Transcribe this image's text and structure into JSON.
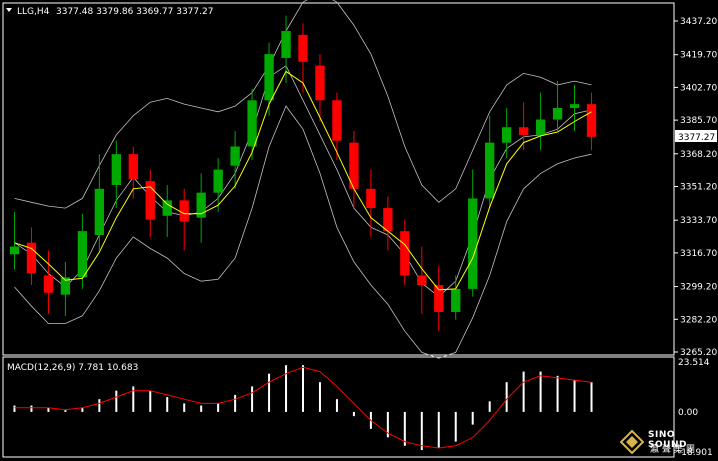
{
  "header": {
    "symbol": "LLG,H4",
    "ohlc": "3377.48 3379.86 3369.77 3377.27"
  },
  "price_axis": {
    "ticks": [
      "3437.20",
      "3419.70",
      "3402.70",
      "3385.70",
      "3368.20",
      "3351.20",
      "3333.70",
      "3316.70",
      "3299.20",
      "3282.20",
      "3265.20"
    ],
    "current_price": "3377.27"
  },
  "macd": {
    "label": "MACD(12,26,9) 7.781 10.683",
    "ticks": [
      "23.514",
      "0.00",
      "-18.901"
    ]
  },
  "logo": {
    "name": "SINO SOUND",
    "chinese": "瀛聲集團"
  },
  "colors": {
    "background": "#000000",
    "bull_candle": "#00aa00",
    "bear_candle": "#ff0000",
    "bands": "#c0c0c0",
    "ma": "#ffff00",
    "signal": "#ff0000",
    "histogram": "#ffffff",
    "axis": "#ffffff"
  },
  "chart_data": [
    {
      "type": "candlestick",
      "title": "LLG,H4",
      "indicators": [
        "Bollinger Bands",
        "Moving Average"
      ],
      "ylim": [
        3265.2,
        3445
      ],
      "bands_upper": [
        3345,
        3343,
        3341,
        3340,
        3345,
        3362,
        3378,
        3388,
        3395,
        3397,
        3394,
        3392,
        3390,
        3393,
        3400,
        3414,
        3432,
        3447,
        3452,
        3447,
        3435,
        3420,
        3398,
        3372,
        3352,
        3343,
        3350,
        3370,
        3390,
        3404,
        3410,
        3408,
        3404,
        3406,
        3404
      ],
      "bands_mid": [
        3322,
        3316,
        3306,
        3299,
        3308,
        3326,
        3344,
        3356,
        3346,
        3338,
        3336,
        3338,
        3345,
        3358,
        3380,
        3408,
        3414,
        3396,
        3378,
        3360,
        3340,
        3330,
        3326,
        3316,
        3301,
        3294,
        3302,
        3326,
        3355,
        3371,
        3377,
        3378,
        3381,
        3389,
        3391
      ],
      "bands_lower": [
        3299,
        3289,
        3280,
        3280,
        3284,
        3297,
        3314,
        3325,
        3319,
        3314,
        3306,
        3302,
        3303,
        3314,
        3340,
        3372,
        3393,
        3381,
        3358,
        3330,
        3312,
        3300,
        3290,
        3276,
        3265,
        3262,
        3265,
        3283,
        3305,
        3333,
        3350,
        3358,
        3363,
        3366,
        3368
      ],
      "candles": [
        [
          3316,
          3320,
          3338,
          3308
        ],
        [
          3322,
          3306,
          3330,
          3300
        ],
        [
          3305,
          3296,
          3318,
          3285
        ],
        [
          3295,
          3304,
          3312,
          3284
        ],
        [
          3304,
          3328,
          3337,
          3298
        ],
        [
          3326,
          3350,
          3368,
          3318
        ],
        [
          3352,
          3368,
          3375,
          3340
        ],
        [
          3368,
          3355,
          3372,
          3345
        ],
        [
          3354,
          3334,
          3360,
          3325
        ],
        [
          3336,
          3344,
          3352,
          3325
        ],
        [
          3344,
          3333,
          3350,
          3318
        ],
        [
          3335,
          3348,
          3358,
          3322
        ],
        [
          3348,
          3360,
          3366,
          3338
        ],
        [
          3362,
          3372,
          3380,
          3350
        ],
        [
          3372,
          3396,
          3402,
          3365
        ],
        [
          3396,
          3420,
          3426,
          3388
        ],
        [
          3418,
          3432,
          3440,
          3405
        ],
        [
          3430,
          3416,
          3436,
          3400
        ],
        [
          3414,
          3396,
          3420,
          3385
        ],
        [
          3396,
          3375,
          3400,
          3365
        ],
        [
          3374,
          3350,
          3380,
          3340
        ],
        [
          3350,
          3340,
          3360,
          3325
        ],
        [
          3340,
          3328,
          3346,
          3318
        ],
        [
          3328,
          3305,
          3334,
          3300
        ],
        [
          3305,
          3300,
          3320,
          3285
        ],
        [
          3300,
          3286,
          3310,
          3276
        ],
        [
          3286,
          3298,
          3305,
          3282
        ],
        [
          3298,
          3345,
          3360,
          3294
        ],
        [
          3345,
          3374,
          3388,
          3340
        ],
        [
          3374,
          3382,
          3392,
          3366
        ],
        [
          3382,
          3378,
          3395,
          3370
        ],
        [
          3378,
          3386,
          3400,
          3370
        ],
        [
          3386,
          3392,
          3406,
          3380
        ],
        [
          3392,
          3394,
          3404,
          3380
        ],
        [
          3394,
          3377,
          3400,
          3370
        ]
      ]
    },
    {
      "type": "bar",
      "title": "MACD(12,26,9) 7.781 10.683",
      "ylim": [
        -18.901,
        23.514
      ],
      "macd": [
        3,
        3,
        2,
        1,
        2,
        6,
        10,
        12,
        10,
        7,
        4,
        3,
        4,
        8,
        12,
        18,
        22,
        22,
        14,
        6,
        -2,
        -8,
        -12,
        -16,
        -18,
        -17,
        -14,
        -6,
        5,
        14,
        19,
        19,
        17,
        15,
        14
      ],
      "signal": [
        2,
        2,
        2,
        1,
        2,
        4,
        7,
        10,
        10,
        8,
        6,
        4,
        4,
        6,
        9,
        14,
        18,
        21,
        19,
        12,
        4,
        -4,
        -10,
        -14,
        -16,
        -17,
        -16,
        -12,
        -4,
        6,
        14,
        17,
        16,
        15,
        14
      ]
    }
  ]
}
